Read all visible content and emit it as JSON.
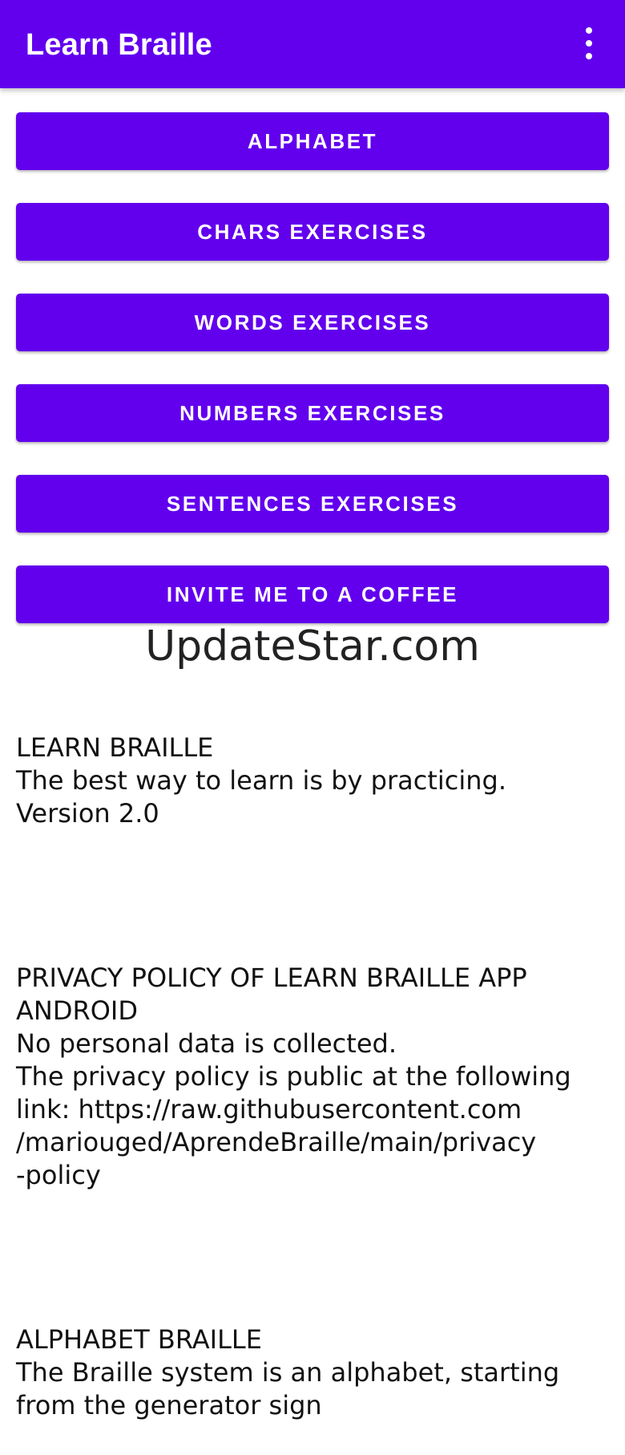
{
  "app_bar": {
    "title": "Learn Braille",
    "menu_icon": "more-vert-icon"
  },
  "buttons": [
    {
      "label": "ALPHABET"
    },
    {
      "label": "CHARS EXERCISES"
    },
    {
      "label": "WORDS EXERCISES"
    },
    {
      "label": "NUMBERS EXERCISES"
    },
    {
      "label": "SENTENCES EXERCISES"
    },
    {
      "label": "INVITE ME TO A COFFEE"
    }
  ],
  "watermark": "UpdateStar.com",
  "info": {
    "about": "LEARN BRAILLE\nThe best way to learn is by practicing.\nVersion 2.0",
    "privacy": "PRIVACY POLICY OF LEARN BRAILLE APP ANDROID\nNo personal data is collected.\nThe privacy policy is public at the following link: https://raw.githubusercontent.com\n/mariouged/AprendeBraille/main/privacy\n-policy",
    "alphabet": "ALPHABET BRAILLE\nThe Braille system is an alphabet, starting from the generator sign"
  },
  "colors": {
    "primary": "#6200EE",
    "on_primary": "#FFFFFF",
    "text": "#111111"
  }
}
